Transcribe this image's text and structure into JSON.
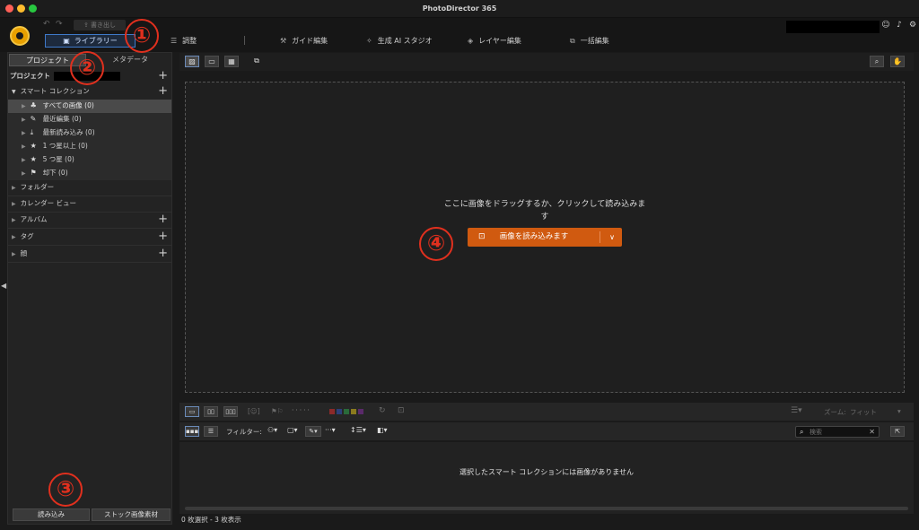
{
  "window": {
    "title": "PhotoDirector 365",
    "traffic_light_colors": [
      "#fe5f57",
      "#febc2e",
      "#28c840"
    ]
  },
  "menubar": {
    "undo_icon": "undo-icon",
    "redo_icon": "redo-icon",
    "export_label": "書き出し",
    "tabs": [
      {
        "label": "ライブラリー",
        "icon": "library-icon"
      },
      {
        "label": "調整",
        "icon": "sliders-icon"
      },
      {
        "label": "ガイド編集",
        "icon": "wand-icon"
      },
      {
        "label": "生成 AI スタジオ",
        "icon": "sparkle-icon"
      },
      {
        "label": "レイヤー編集",
        "icon": "layers-icon"
      },
      {
        "label": "一括編集",
        "icon": "batch-icon"
      }
    ],
    "right_icons": [
      "account-icon",
      "bell-icon",
      "gear-icon"
    ]
  },
  "left_panel": {
    "tabs": [
      "プロジェクト",
      "メタデータ"
    ],
    "project_label": "プロジェクト",
    "smart_collection_label": "スマート コレクション",
    "smart_items": [
      {
        "label": "すべての画像 (0)",
        "selected": true
      },
      {
        "label": "最近編集 (0)"
      },
      {
        "label": "最新読み込み (0)"
      },
      {
        "label": "1 つ星以上 (0)"
      },
      {
        "label": "5 つ星 (0)"
      },
      {
        "label": "却下 (0)"
      }
    ],
    "sections": [
      {
        "label": "フォルダー",
        "has_add": false
      },
      {
        "label": "カレンダー ビュー",
        "has_add": false
      },
      {
        "label": "アルバム",
        "has_add": true
      },
      {
        "label": "タグ",
        "has_add": true
      },
      {
        "label": "顔",
        "has_add": true
      }
    ],
    "buttons": {
      "import": "読み込み",
      "stock": "ストック画像素材"
    }
  },
  "main": {
    "drop_message_line1": "ここに画像をドラッグするか、クリックして読み込みま",
    "drop_message_line2": "す",
    "import_button": "画像を読み込みます"
  },
  "toolbar2": {
    "zoom_label": "ズーム:",
    "zoom_value": "フィット",
    "color_labels": [
      "#8b2a2a",
      "#2c3f7a",
      "#2a6a3a",
      "#8a7a1e",
      "#5a2a6a"
    ]
  },
  "toolbar3": {
    "filter_label": "フィルター:",
    "search_placeholder": "検索"
  },
  "filmstrip": {
    "empty_message": "選択したスマート コレクションには画像がありません"
  },
  "status": {
    "text": "0 枚選択 - 3 枚表示"
  },
  "annotations": [
    "①",
    "②",
    "③",
    "④"
  ]
}
